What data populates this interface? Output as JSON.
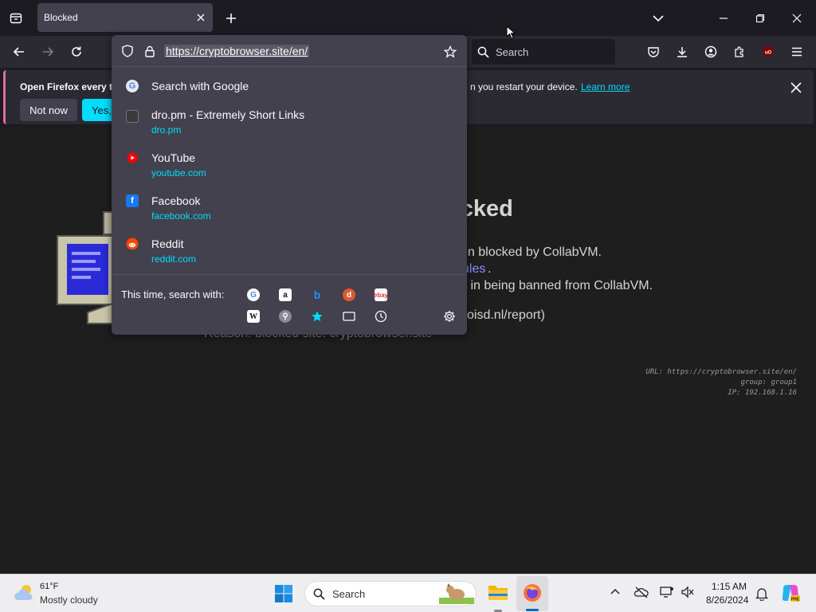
{
  "tabstrip": {
    "active_tab_title": "Blocked"
  },
  "navbar": {
    "search_placeholder": "Search"
  },
  "notification": {
    "message_start": "Open Firefox every ti",
    "message_end": "n you restart your device.",
    "learn_more": "Learn more",
    "not_now": "Not now",
    "yes": "Yes, c"
  },
  "urlbar": {
    "url": "https://cryptobrowser.site/en/",
    "suggestions": [
      {
        "title": "Search with Google",
        "url": ""
      },
      {
        "title": "dro.pm - Extremely Short Links",
        "url": "dro.pm"
      },
      {
        "title": "YouTube",
        "url": "youtube.com"
      },
      {
        "title": "Facebook",
        "url": "facebook.com"
      },
      {
        "title": "Reddit",
        "url": "reddit.com"
      }
    ],
    "search_with_label": "This time, search with:"
  },
  "page": {
    "title_partial": "ocked",
    "line1": "en blocked by CollabVM.",
    "line2_link": "ules",
    "line2_end": ".",
    "line3": "lt in being banned from CollabVM.",
    "line4": "oisd.nl/report)",
    "line5": "Reason: blocked site: cryptobrowser.site",
    "meta_url": "URL: https://cryptobrowser.site/en/",
    "meta_group": "group: group1",
    "meta_ip": "IP: 192.168.1.16"
  },
  "taskbar": {
    "weather_temp": "61°F",
    "weather_desc": "Mostly cloudy",
    "search_label": "Search",
    "time": "1:15 AM",
    "date": "8/26/2024"
  },
  "colors": {
    "accent": "#00ddff",
    "panel": "#42414d",
    "toolbar": "#2b2a33",
    "background": "#1c1b22"
  }
}
